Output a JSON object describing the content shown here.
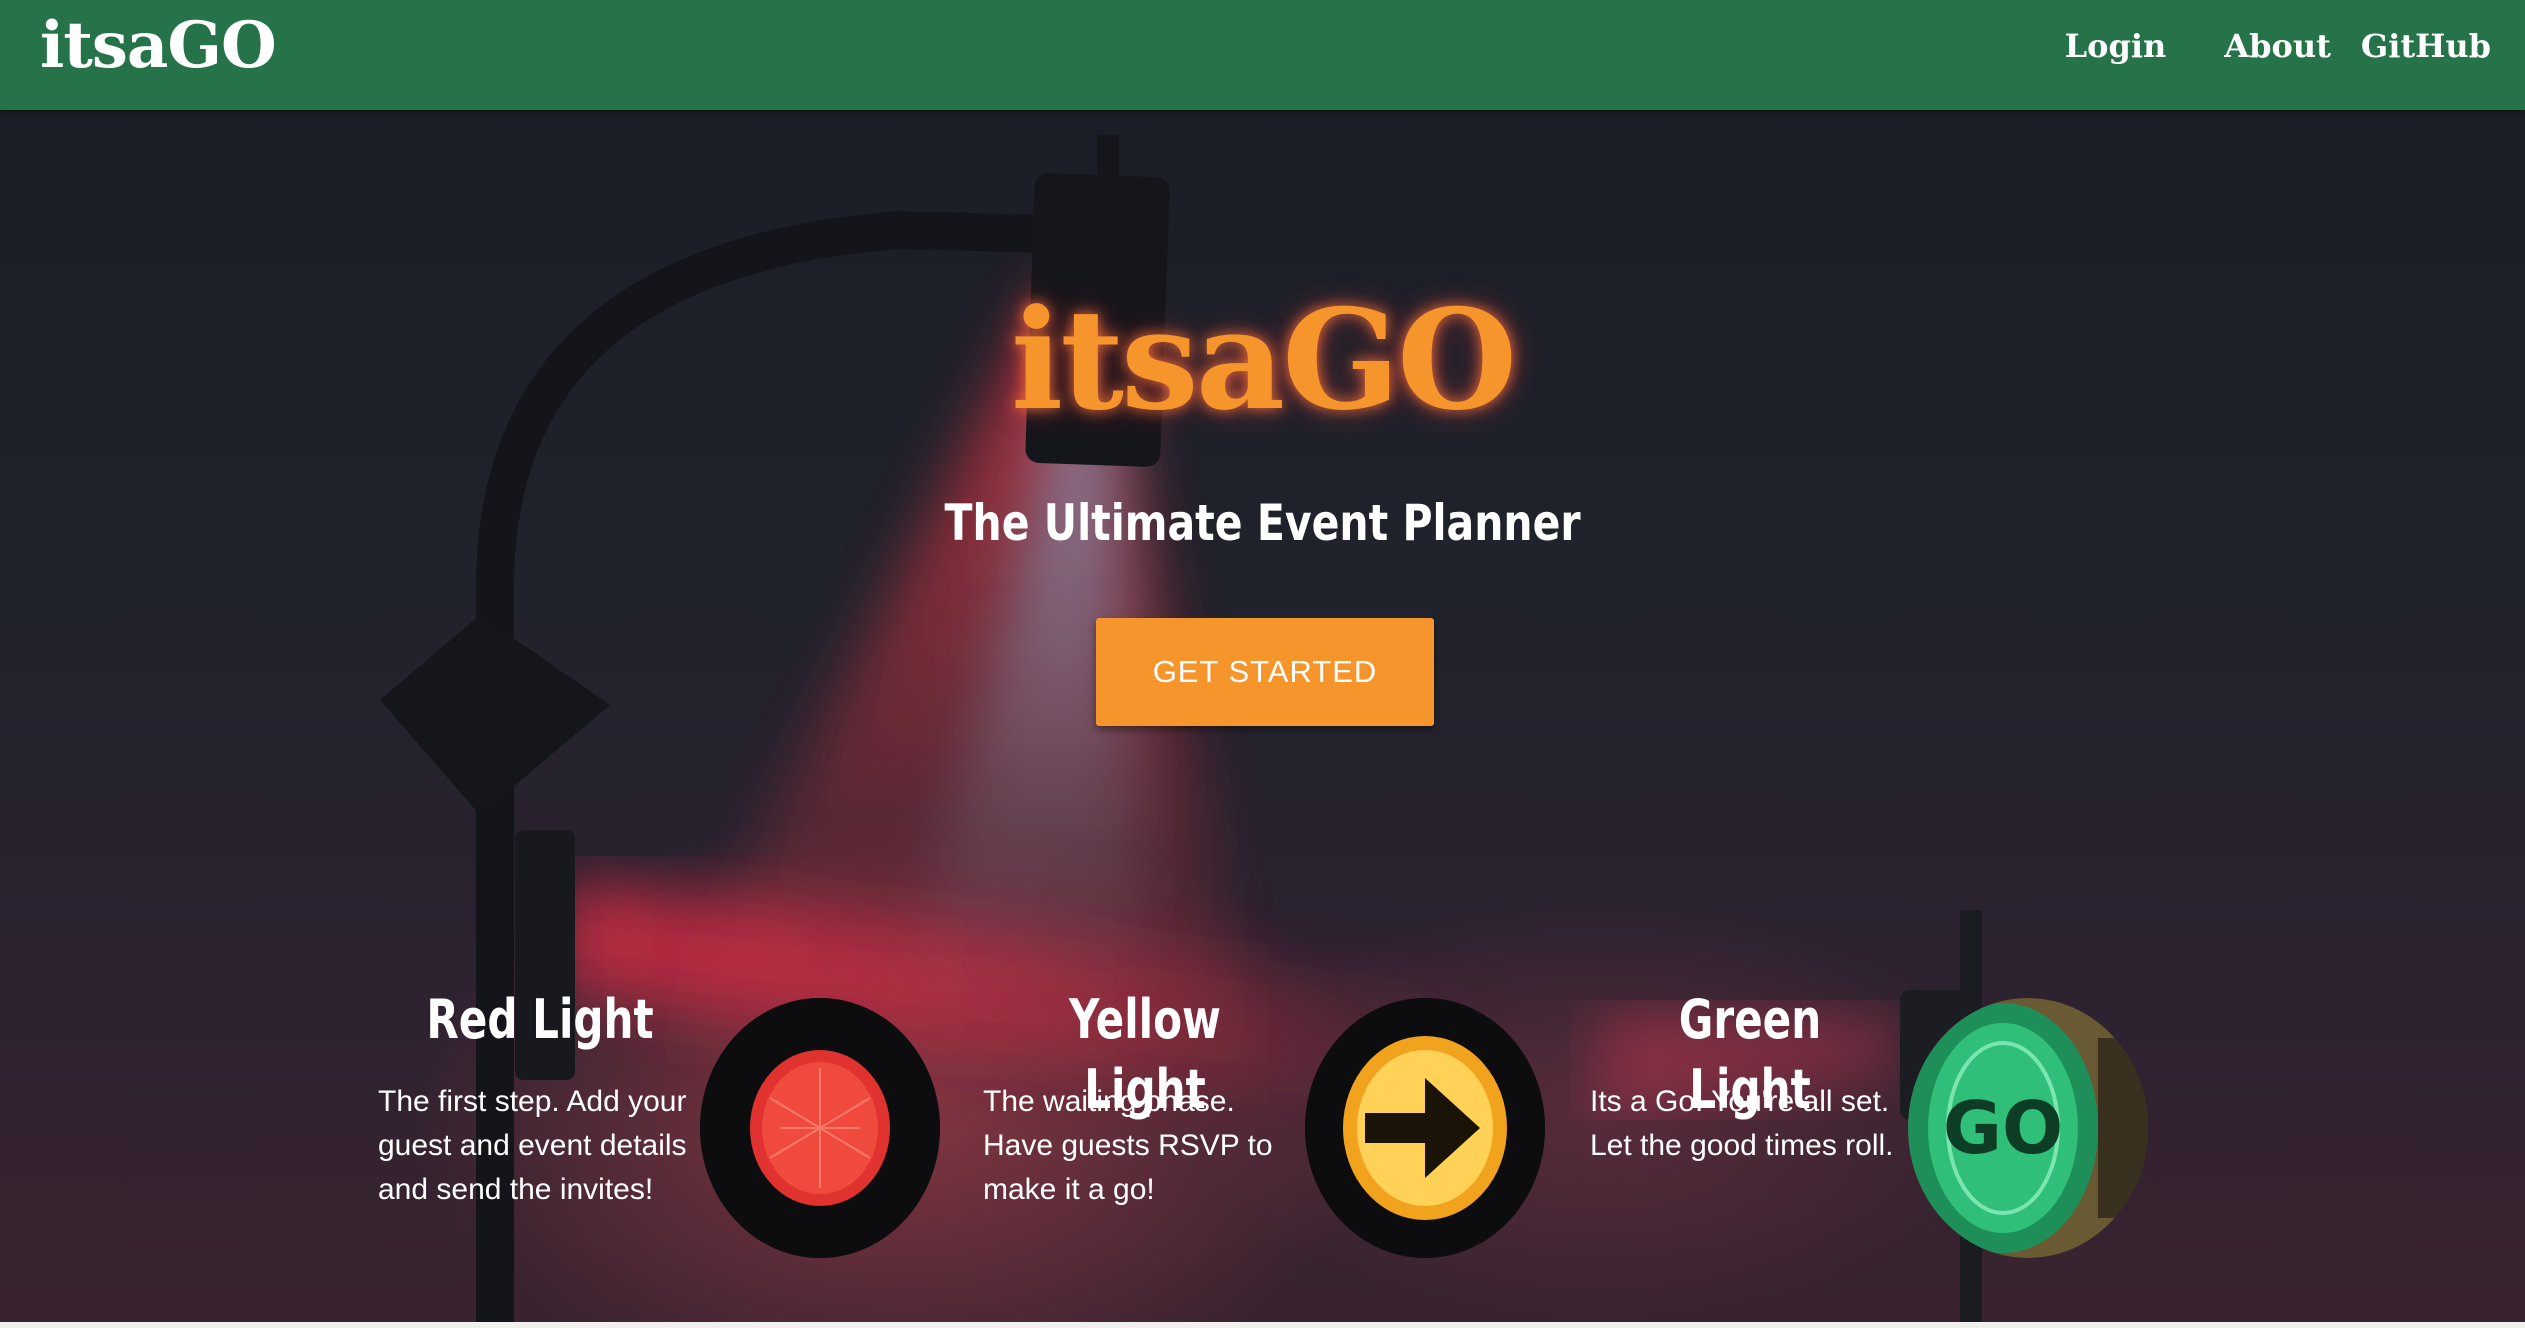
{
  "navbar": {
    "brand": "itsaGO",
    "links": [
      "Login",
      "About",
      "GitHub"
    ],
    "background_color": "#26734a"
  },
  "hero": {
    "title": "itsaGO",
    "subtitle": "The Ultimate Event Planner",
    "cta_label": "GET STARTED",
    "accent_color": "#f7952d"
  },
  "features": [
    {
      "title": "Red Light",
      "description": "The first step. Add your guest and event details and send the invites!",
      "icon": "red-traffic-light-icon"
    },
    {
      "title": "Yellow Light",
      "description": "The waiting phase. Have guests RSVP to make it a go!",
      "icon": "yellow-arrow-light-icon"
    },
    {
      "title": "Green Light",
      "description": "Its a Go! You're all set. Let the good times roll.",
      "icon": "green-go-light-icon"
    }
  ]
}
